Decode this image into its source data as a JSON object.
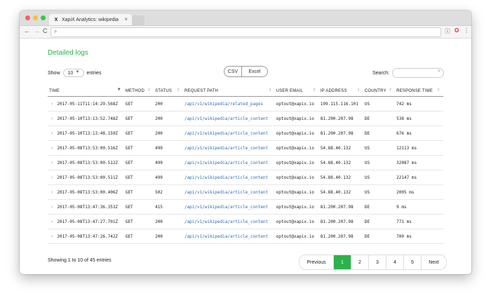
{
  "browser": {
    "tab_title": "XapiX Analytics: wikipedia",
    "tab_close": "×",
    "favicon": "X",
    "nav": {
      "back": "←",
      "forward": "→",
      "reload": "C"
    }
  },
  "page": {
    "heading": "Detailed logs",
    "show_label": "Show",
    "show_value": "10",
    "entries_label": "entries",
    "export_buttons": [
      "CSV",
      "Excel"
    ],
    "search_label": "Search:",
    "search_value": ""
  },
  "table": {
    "columns": [
      "TIME",
      "METHOD",
      "STATUS",
      "REQUEST PATH",
      "USER EMAIL",
      "IP ADDRESS",
      "COUNTRY",
      "RESPONSE TIME"
    ],
    "rows": [
      [
        "2017-05-11T11:14:29.568Z",
        "GET",
        "200",
        "/api/v1/wikipedia/related_pages",
        "optout@xapix.io",
        "199.115.116.101",
        "US",
        "742 ms"
      ],
      [
        "2017-05-10T13:13:52.748Z",
        "GET",
        "200",
        "/api/v1/wikipedia/article_content",
        "optout@xapix.io",
        "81.200.207.98",
        "DE",
        "538 ms"
      ],
      [
        "2017-05-10T13:13:48.159Z",
        "GET",
        "200",
        "/api/v1/wikipedia/article_content",
        "optout@xapix.io",
        "81.200.207.98",
        "DE",
        "676 ms"
      ],
      [
        "2017-05-08T13:53:00.516Z",
        "GET",
        "499",
        "/api/v1/wikipedia/article_content",
        "optout@xapix.io",
        "54.88.40.132",
        "US",
        "12113 ms"
      ],
      [
        "2017-05-08T13:53:00.512Z",
        "GET",
        "499",
        "/api/v1/wikipedia/article_content",
        "optout@xapix.io",
        "54.88.40.132",
        "US",
        "32087 ms"
      ],
      [
        "2017-05-08T13:53:00.511Z",
        "GET",
        "499",
        "/api/v1/wikipedia/article_content",
        "optout@xapix.io",
        "54.88.40.132",
        "US",
        "22147 ms"
      ],
      [
        "2017-05-08T13:53:00.406Z",
        "GET",
        "502",
        "/api/v1/wikipedia/article_content",
        "optout@xapix.io",
        "54.88.40.132",
        "US",
        "2005 ms"
      ],
      [
        "2017-05-08T13:47:36.353Z",
        "GET",
        "415",
        "/api/v1/wikipedia/article_content",
        "optout@xapix.io",
        "81.200.207.98",
        "DE",
        "9 ms"
      ],
      [
        "2017-05-08T13:47:27.701Z",
        "GET",
        "200",
        "/api/v1/wikipedia/article_content",
        "optout@xapix.io",
        "81.200.207.98",
        "DE",
        "771 ms"
      ],
      [
        "2017-05-08T13:47:26.742Z",
        "GET",
        "200",
        "/api/v1/wikipedia/article_content",
        "optout@xapix.io",
        "81.200.207.98",
        "DE",
        "700 ms"
      ]
    ]
  },
  "footer": {
    "info": "Showing 1 to 10 of 45 entries",
    "pagination": {
      "previous": "Previous",
      "pages": [
        "1",
        "2",
        "3",
        "4",
        "5"
      ],
      "active": "1",
      "next": "Next"
    }
  },
  "colors": {
    "accent": "#2bb24c",
    "link": "#2a6cb0"
  }
}
